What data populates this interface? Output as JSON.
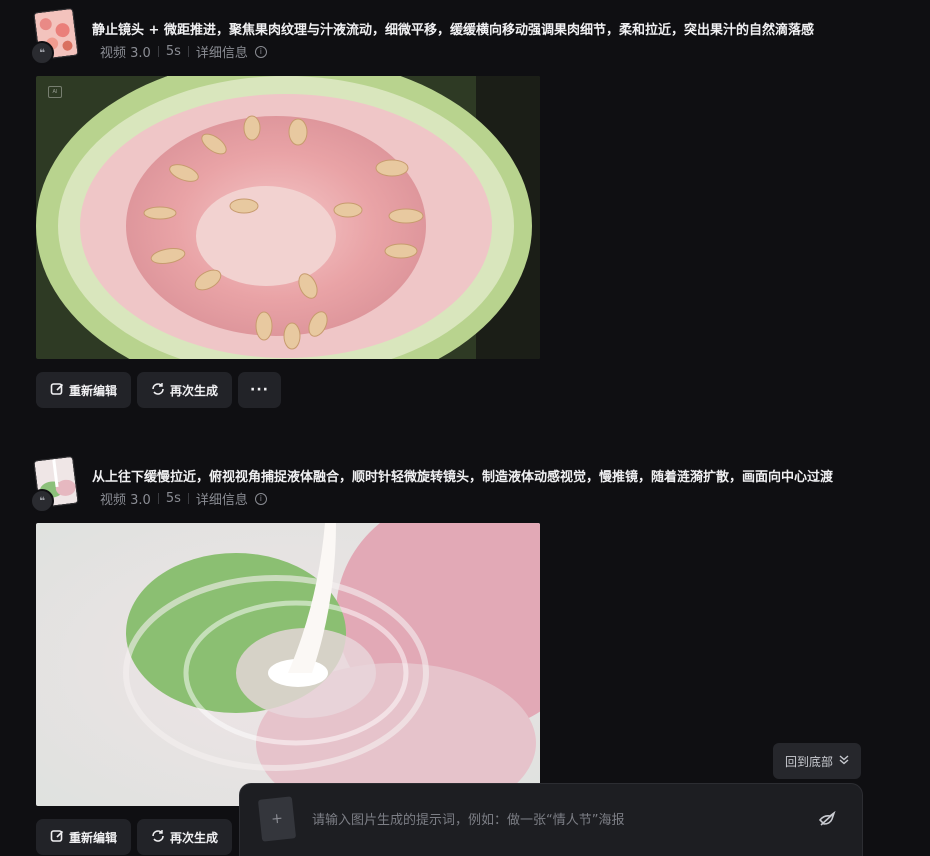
{
  "items": [
    {
      "prompt": "静止镜头 + 微距推进，聚焦果肉纹理与汁液流动，细微平移，缓缓横向移动强调果肉细节，柔和拉近，突出果汁的自然滴落感",
      "model": "视频 3.0",
      "duration": "5s",
      "details_label": "详细信息",
      "quote_icon": "quote-icon",
      "ai_badge": "AI"
    },
    {
      "prompt": "从上往下缓慢拉近，俯视视角捕捉液体融合，顺时针轻微旋转镜头，制造液体动感视觉，慢推镜，随着涟漪扩散，画面向中心过渡",
      "model": "视频 3.0",
      "duration": "5s",
      "details_label": "详细信息",
      "quote_icon": "quote-icon"
    }
  ],
  "actions": {
    "reedit_label": "重新编辑",
    "regenerate_label": "再次生成",
    "more_label": "···"
  },
  "back_to_bottom_label": "回到底部",
  "composer": {
    "placeholder": "请输入图片生成的提示词，例如：做一张“情人节”海报",
    "upload_icon": "plus-icon",
    "send_icon": "send-icon"
  }
}
